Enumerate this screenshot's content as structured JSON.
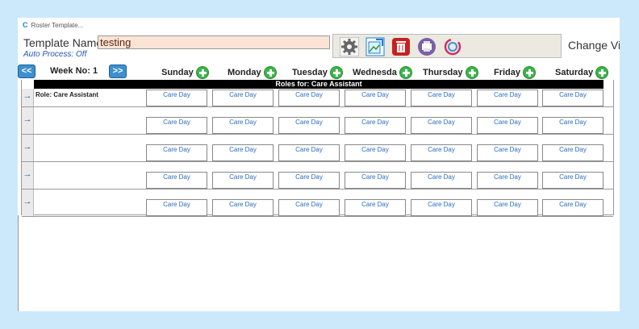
{
  "window": {
    "title": "Roster Template..."
  },
  "template": {
    "label": "Template Name:",
    "name": "testing",
    "auto_process": "Auto Process: Off"
  },
  "toolbar": {
    "buttons": [
      {
        "icon": "gear-icon"
      },
      {
        "icon": "export-icon"
      },
      {
        "icon": "delete-icon"
      },
      {
        "icon": "print-icon"
      },
      {
        "icon": "refresh-icon"
      }
    ],
    "change_view": "Change Vie"
  },
  "week": {
    "prev": "<<",
    "label": "Week No: 1",
    "next": ">>"
  },
  "days": [
    "Sunday",
    "Monday",
    "Tuesday",
    "Wednesda",
    "Thursday",
    "Friday",
    "Saturday"
  ],
  "roles_header": "Roles for: Care Assistant",
  "rows": [
    {
      "role": "Role: Care Assistant",
      "cells": [
        "Care Day",
        "Care Day",
        "Care Day",
        "Care Day",
        "Care Day",
        "Care Day",
        "Care Day"
      ]
    },
    {
      "role": "",
      "cells": [
        "Care Day",
        "Care Day",
        "Care Day",
        "Care Day",
        "Care Day",
        "Care Day",
        "Care Day"
      ]
    },
    {
      "role": "",
      "cells": [
        "Care Day",
        "Care Day",
        "Care Day",
        "Care Day",
        "Care Day",
        "Care Day",
        "Care Day"
      ]
    },
    {
      "role": "",
      "cells": [
        "Care Day",
        "Care Day",
        "Care Day",
        "Care Day",
        "Care Day",
        "Care Day",
        "Care Day"
      ]
    },
    {
      "role": "",
      "cells": [
        "Care Day",
        "Care Day",
        "Care Day",
        "Care Day",
        "Care Day",
        "Care Day",
        "Care Day"
      ]
    }
  ],
  "colors": {
    "accent": "#3d8fcf",
    "page_bg": "#cce9fb",
    "input_bg": "#fbe3d6"
  }
}
